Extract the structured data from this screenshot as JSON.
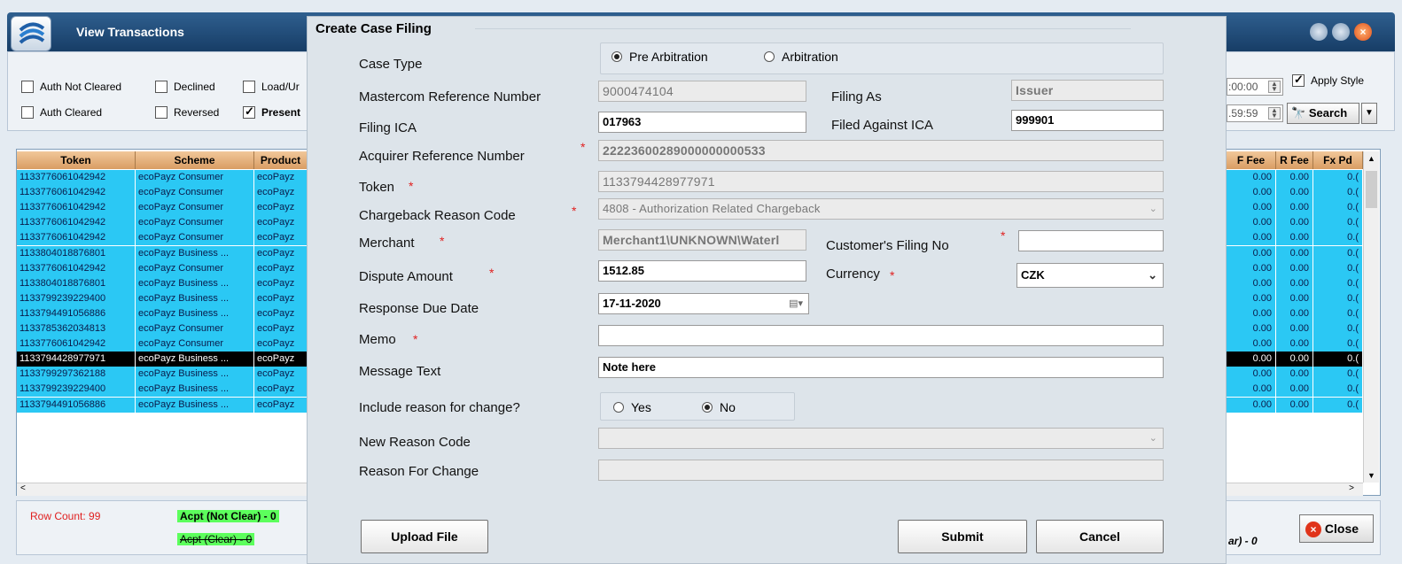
{
  "window": {
    "title": "View Transactions"
  },
  "filters": {
    "left": [
      {
        "label": "Auth Not Cleared",
        "checked": false
      },
      {
        "label": "Auth Cleared",
        "checked": false
      }
    ],
    "mid": [
      {
        "label": "Declined",
        "checked": false
      },
      {
        "label": "Reversed",
        "checked": false
      }
    ],
    "right": [
      {
        "label": "Load/Ur",
        "checked": false
      },
      {
        "label": "Present",
        "checked": true
      }
    ],
    "time_from": ":00:00",
    "time_to": ".59:59",
    "apply_style": "Apply Style",
    "search": "Search"
  },
  "grid": {
    "headers_left": [
      "Token",
      "Scheme",
      "Product"
    ],
    "headers_right": [
      "F Fee",
      "R Fee",
      "Fx Pd"
    ],
    "rows": [
      {
        "token": "1133776061042942",
        "scheme": "ecoPayz Consumer",
        "product": "ecoPayz",
        "ffee": "0.00",
        "rfee": "0.00",
        "fx": "0.(",
        "selected": false
      },
      {
        "token": "1133776061042942",
        "scheme": "ecoPayz Consumer",
        "product": "ecoPayz",
        "ffee": "0.00",
        "rfee": "0.00",
        "fx": "0.(",
        "selected": false
      },
      {
        "token": "1133776061042942",
        "scheme": "ecoPayz Consumer",
        "product": "ecoPayz",
        "ffee": "0.00",
        "rfee": "0.00",
        "fx": "0.(",
        "selected": false
      },
      {
        "token": "1133776061042942",
        "scheme": "ecoPayz Consumer",
        "product": "ecoPayz",
        "ffee": "0.00",
        "rfee": "0.00",
        "fx": "0.(",
        "selected": false
      },
      {
        "token": "1133776061042942",
        "scheme": "ecoPayz Consumer",
        "product": "ecoPayz",
        "ffee": "0.00",
        "rfee": "0.00",
        "fx": "0.(",
        "selected": false
      },
      {
        "token": "1133804018876801",
        "scheme": "ecoPayz Business ...",
        "product": "ecoPayz",
        "ffee": "0.00",
        "rfee": "0.00",
        "fx": "0.(",
        "selected": false
      },
      {
        "token": "1133776061042942",
        "scheme": "ecoPayz Consumer",
        "product": "ecoPayz",
        "ffee": "0.00",
        "rfee": "0.00",
        "fx": "0.(",
        "selected": false
      },
      {
        "token": "1133804018876801",
        "scheme": "ecoPayz Business ...",
        "product": "ecoPayz",
        "ffee": "0.00",
        "rfee": "0.00",
        "fx": "0.(",
        "selected": false
      },
      {
        "token": "1133799239229400",
        "scheme": "ecoPayz Business ...",
        "product": "ecoPayz",
        "ffee": "0.00",
        "rfee": "0.00",
        "fx": "0.(",
        "selected": false
      },
      {
        "token": "1133794491056886",
        "scheme": "ecoPayz Business ...",
        "product": "ecoPayz",
        "ffee": "0.00",
        "rfee": "0.00",
        "fx": "0.(",
        "selected": false
      },
      {
        "token": "1133785362034813",
        "scheme": "ecoPayz Consumer",
        "product": "ecoPayz",
        "ffee": "0.00",
        "rfee": "0.00",
        "fx": "0.(",
        "selected": false
      },
      {
        "token": "1133776061042942",
        "scheme": "ecoPayz Consumer",
        "product": "ecoPayz",
        "ffee": "0.00",
        "rfee": "0.00",
        "fx": "0.(",
        "selected": false
      },
      {
        "token": "1133794428977971",
        "scheme": "ecoPayz Business ...",
        "product": "ecoPayz",
        "ffee": "0.00",
        "rfee": "0.00",
        "fx": "0.(",
        "selected": true
      },
      {
        "token": "1133799297362188",
        "scheme": "ecoPayz Business ...",
        "product": "ecoPayz",
        "ffee": "0.00",
        "rfee": "0.00",
        "fx": "0.(",
        "selected": false
      },
      {
        "token": "1133799239229400",
        "scheme": "ecoPayz Business ...",
        "product": "ecoPayz",
        "ffee": "0.00",
        "rfee": "0.00",
        "fx": "0.(",
        "selected": false
      },
      {
        "token": "1133794491056886",
        "scheme": "ecoPayz Business ...",
        "product": "ecoPayz",
        "ffee": "0.00",
        "rfee": "0.00",
        "fx": "0.(",
        "selected": false
      }
    ]
  },
  "status": {
    "row_count": "Row Count: 99",
    "acpt_not_clear": "Acpt (Not Clear) - 0",
    "acpt_clear": "Acpt (Clear) - 0",
    "right_text": "ar) - 0",
    "close": "Close"
  },
  "modal": {
    "title": "Create Case Filing",
    "case_type_label": "Case Type",
    "case_type_options": [
      "Pre Arbitration",
      "Arbitration"
    ],
    "case_type_selected": "Pre Arbitration",
    "mastercom_label": "Mastercom Reference Number",
    "mastercom_value": "9000474104",
    "filing_as_label": "Filing As",
    "filing_as_value": "Issuer",
    "filing_ica_label": "Filing ICA",
    "filing_ica_value": "017963",
    "filed_against_label": "Filed Against ICA",
    "filed_against_value": "999901",
    "arn_label": "Acquirer Reference Number",
    "arn_value": "22223600289000000000533",
    "token_label": "Token",
    "token_value": "1133794428977971",
    "reason_label": "Chargeback Reason Code",
    "reason_value": "4808 - Authorization Related Chargeback",
    "merchant_label": "Merchant",
    "merchant_value": "Merchant1\\UNKNOWN\\Waterl",
    "customer_filing_label": "Customer's Filing No",
    "customer_filing_value": "",
    "dispute_label": "Dispute Amount",
    "dispute_value": "1512.85",
    "currency_label": "Currency",
    "currency_value": "CZK",
    "due_label": "Response Due Date",
    "due_value": "17-11-2020",
    "memo_label": "Memo",
    "memo_value": "",
    "message_label": "Message Text",
    "message_value": "Note here",
    "include_label": "Include reason for change?",
    "include_options": [
      "Yes",
      "No"
    ],
    "include_selected": "No",
    "new_reason_label": "New Reason Code",
    "new_reason_value": "",
    "reason_change_label": "Reason For Change",
    "reason_change_value": "",
    "required_mark": "*",
    "upload_label": "Upload File",
    "submit_label": "Submit",
    "cancel_label": "Cancel"
  }
}
